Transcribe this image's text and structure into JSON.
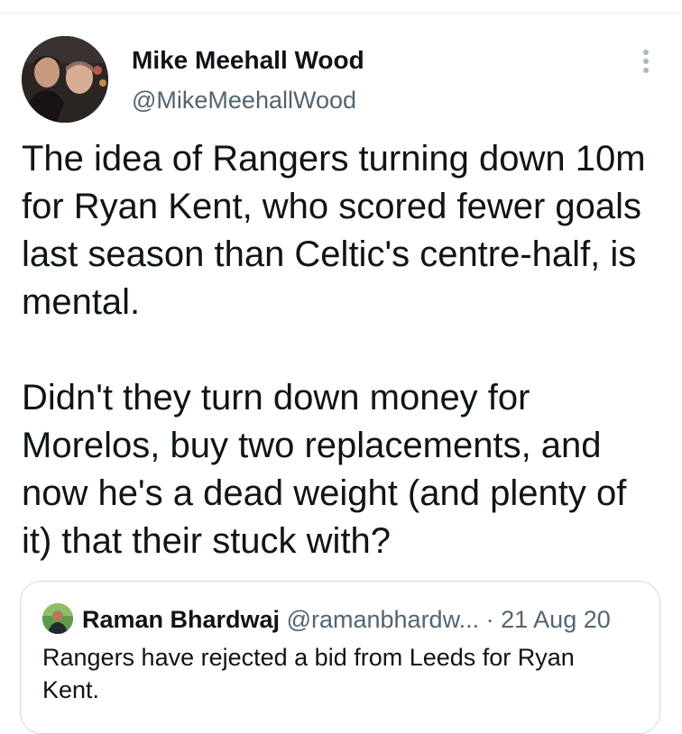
{
  "tweet": {
    "author_name": "Mike Meehall Wood",
    "author_handle": "@MikeMeehallWood",
    "paragraphs": [
      "The idea of Rangers turning down 10m for Ryan Kent, who scored fewer goals last season than Celtic's centre-half, is mental.",
      "Didn't they turn down money for Morelos, buy two replacements, and now he's a dead weight (and plenty of it) that their stuck with?"
    ]
  },
  "quote": {
    "author_name": "Raman Bhardwaj",
    "author_handle": "@ramanbhardw...",
    "separator": "·",
    "date": "21 Aug 20",
    "text": "Rangers have rejected a bid from Leeds for Ryan Kent."
  },
  "icons": {
    "more": "more-vertical-icon"
  },
  "colors": {
    "text_primary": "#0f1419",
    "text_secondary": "#536471",
    "border": "#cfd9de"
  }
}
